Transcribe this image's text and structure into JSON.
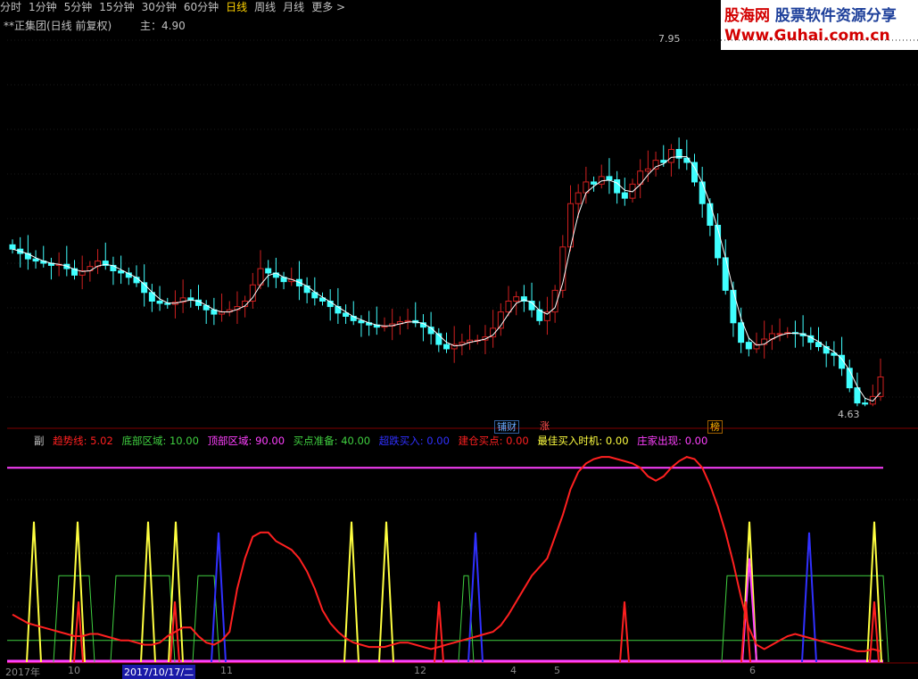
{
  "toolbar": {
    "items": [
      "分时",
      "1分钟",
      "5分钟",
      "15分钟",
      "30分钟",
      "60分钟",
      "日线",
      "周线",
      "月线",
      "更多 >"
    ],
    "active_index": 6
  },
  "stock": {
    "title": "**正集团(日线 前复权)",
    "main_label": "主：4.90"
  },
  "logo": {
    "brand": "股海网",
    "slogan": "股票软件资源分享",
    "url": "Www.Guhai.com.cn"
  },
  "price_labels": {
    "high": "7.95",
    "low": "4.63"
  },
  "tags": [
    {
      "text": "铺财",
      "color": "#66aaff"
    },
    {
      "text": "涨",
      "color": "#ff5050"
    },
    {
      "text": "榜",
      "color": "#ffb000"
    }
  ],
  "sub_indicator": {
    "prefix": "副",
    "items": [
      {
        "label": "趋势线: 5.02",
        "color": "#ff2020"
      },
      {
        "label": "底部区域: 10.00",
        "color": "#40d040"
      },
      {
        "label": "顶部区域: 90.00",
        "color": "#ff40ff"
      },
      {
        "label": "买点准备: 40.00",
        "color": "#40d040"
      },
      {
        "label": "超跌买入: 0.00",
        "color": "#3030ff"
      },
      {
        "label": "建仓买点: 0.00",
        "color": "#ff2020"
      },
      {
        "label": "最佳买入时机: 0.00",
        "color": "#ffff40"
      },
      {
        "label": "庄家出现: 0.00",
        "color": "#ff40ff"
      }
    ]
  },
  "date_axis": {
    "labels": [
      "2017年",
      "10",
      "2017/10/17/二",
      "11",
      "12",
      "4",
      "5",
      "6"
    ],
    "selected": "2017/10/17/二"
  },
  "colors": {
    "up": "#d02020",
    "down": "#40ffff",
    "ma": "#ffffff",
    "trend": "#ff2020",
    "buy_prep": "#40d040",
    "best_buy": "#ffff40",
    "oversold": "#3030ff",
    "banker": "#ff40ff"
  },
  "chart_data": [
    {
      "type": "candlestick",
      "title": "**正集团(日线 前复权)",
      "price_range": [
        4.63,
        7.95
      ],
      "closes": [
        6.08,
        6.04,
        5.99,
        5.97,
        5.95,
        5.93,
        5.94,
        5.9,
        5.84,
        5.88,
        5.92,
        5.97,
        5.93,
        5.88,
        5.86,
        5.82,
        5.77,
        5.68,
        5.6,
        5.58,
        5.57,
        5.59,
        5.63,
        5.61,
        5.56,
        5.52,
        5.48,
        5.5,
        5.52,
        5.55,
        5.6,
        5.75,
        5.9,
        5.86,
        5.82,
        5.78,
        5.8,
        5.74,
        5.68,
        5.63,
        5.6,
        5.55,
        5.49,
        5.46,
        5.42,
        5.4,
        5.38,
        5.36,
        5.37,
        5.39,
        5.41,
        5.42,
        5.4,
        5.36,
        5.3,
        5.2,
        5.16,
        5.2,
        5.22,
        5.24,
        5.24,
        5.27,
        5.35,
        5.5,
        5.6,
        5.64,
        5.6,
        5.52,
        5.42,
        5.5,
        5.7,
        6.1,
        6.5,
        6.6,
        6.7,
        6.68,
        6.75,
        6.72,
        6.6,
        6.55,
        6.68,
        6.8,
        6.82,
        6.9,
        6.88,
        7.0,
        6.92,
        6.88,
        6.7,
        6.5,
        6.3,
        6.0,
        5.7,
        5.4,
        5.22,
        5.16,
        5.2,
        5.25,
        5.3,
        5.3,
        5.31,
        5.3,
        5.28,
        5.22,
        5.18,
        5.12,
        5.1,
        4.98,
        4.8,
        4.66,
        4.65,
        4.72,
        4.9
      ],
      "high": 7.95,
      "low": 4.63
    },
    {
      "type": "line",
      "ylim": [
        0,
        100
      ],
      "series": [
        {
          "name": "趋势线",
          "values": [
            22,
            20,
            18,
            17,
            16,
            15,
            14,
            13,
            12,
            12,
            13,
            13,
            12,
            11,
            10,
            10,
            9,
            8,
            8,
            9,
            12,
            14,
            16,
            16,
            12,
            9,
            8,
            10,
            14,
            34,
            48,
            58,
            60,
            60,
            56,
            54,
            52,
            48,
            42,
            34,
            24,
            18,
            14,
            11,
            9,
            8,
            7,
            7,
            7,
            8,
            9,
            9,
            8,
            7,
            6,
            7,
            8,
            9,
            10,
            11,
            12,
            13,
            14,
            17,
            22,
            28,
            34,
            40,
            44,
            48,
            58,
            68,
            80,
            88,
            92,
            94,
            95,
            95,
            94,
            93,
            92,
            90,
            86,
            84,
            86,
            90,
            93,
            95,
            94,
            90,
            82,
            72,
            60,
            46,
            30,
            16,
            8,
            6,
            8,
            10,
            12,
            13,
            12,
            11,
            10,
            9,
            8,
            7,
            6,
            5,
            5,
            6,
            5
          ]
        },
        {
          "name": "底部区域",
          "values": [
            10,
            10
          ]
        },
        {
          "name": "顶部区域",
          "values": [
            90,
            90
          ]
        }
      ]
    }
  ]
}
